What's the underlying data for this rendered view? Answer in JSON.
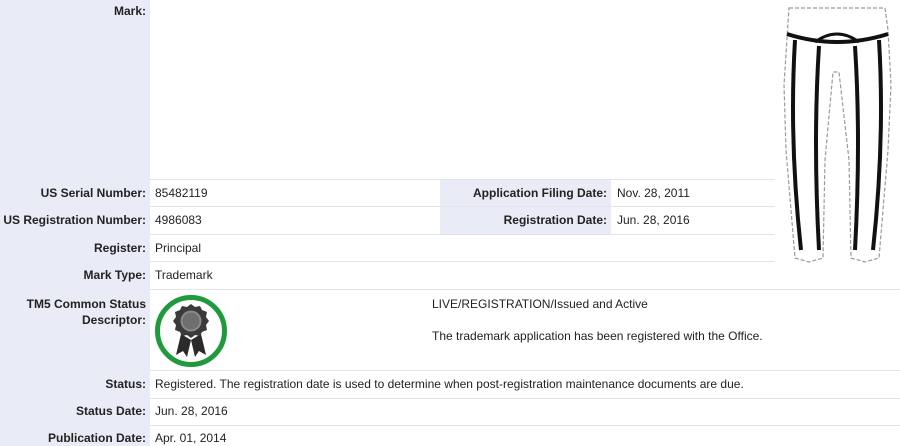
{
  "mark": {
    "label": "Mark:",
    "image_icon": "leggings-drawing-icon"
  },
  "serial": {
    "label": "US Serial Number:",
    "value": "85482119"
  },
  "filing_date": {
    "label": "Application Filing Date:",
    "value": "Nov. 28, 2011"
  },
  "registration_number": {
    "label": "US Registration Number:",
    "value": "4986083"
  },
  "registration_date": {
    "label": "Registration Date:",
    "value": "Jun. 28, 2016"
  },
  "register": {
    "label": "Register:",
    "value": "Principal"
  },
  "mark_type": {
    "label": "Mark Type:",
    "value": "Trademark"
  },
  "tm5": {
    "label_line1": "TM5 Common Status",
    "label_line2": "Descriptor:",
    "badge_icon": "registered-ribbon-badge-icon",
    "badge_color": "#1f9a3c",
    "status_code": "LIVE/REGISTRATION/Issued and Active",
    "description": "The trademark application has been registered with the Office."
  },
  "status": {
    "label": "Status:",
    "value": "Registered. The registration date is used to determine when post-registration maintenance documents are due."
  },
  "status_date": {
    "label": "Status Date:",
    "value": "Jun. 28, 2016"
  },
  "publication_date": {
    "label": "Publication Date:",
    "value": "Apr. 01, 2014"
  }
}
